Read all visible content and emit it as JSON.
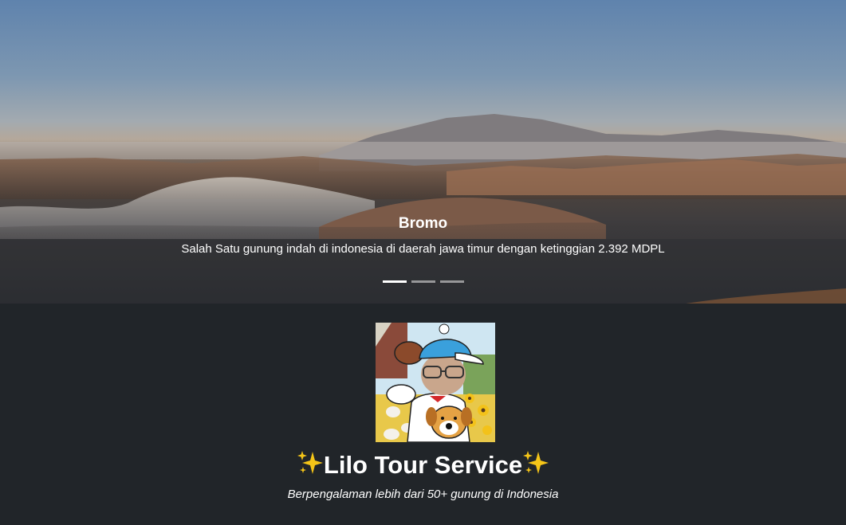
{
  "carousel": {
    "slide_title": "Bromo",
    "slide_caption": "Salah Satu gunung indah di indonesia di daerah jawa timur dengan ketinggian 2.392 MDPL",
    "indicator_count": 3,
    "active_indicator": 1
  },
  "profile": {
    "image_description": "cartoon-avatar"
  },
  "brand": {
    "title": "Lilo Tour Service",
    "tagline": "Berpengalaman lebih dari 50+ gunung di Indonesia",
    "sparkle_icon": "sparkles-icon"
  },
  "colors": {
    "page_background": "#212529",
    "text": "#ffffff",
    "sparkle": "#f5c518"
  }
}
